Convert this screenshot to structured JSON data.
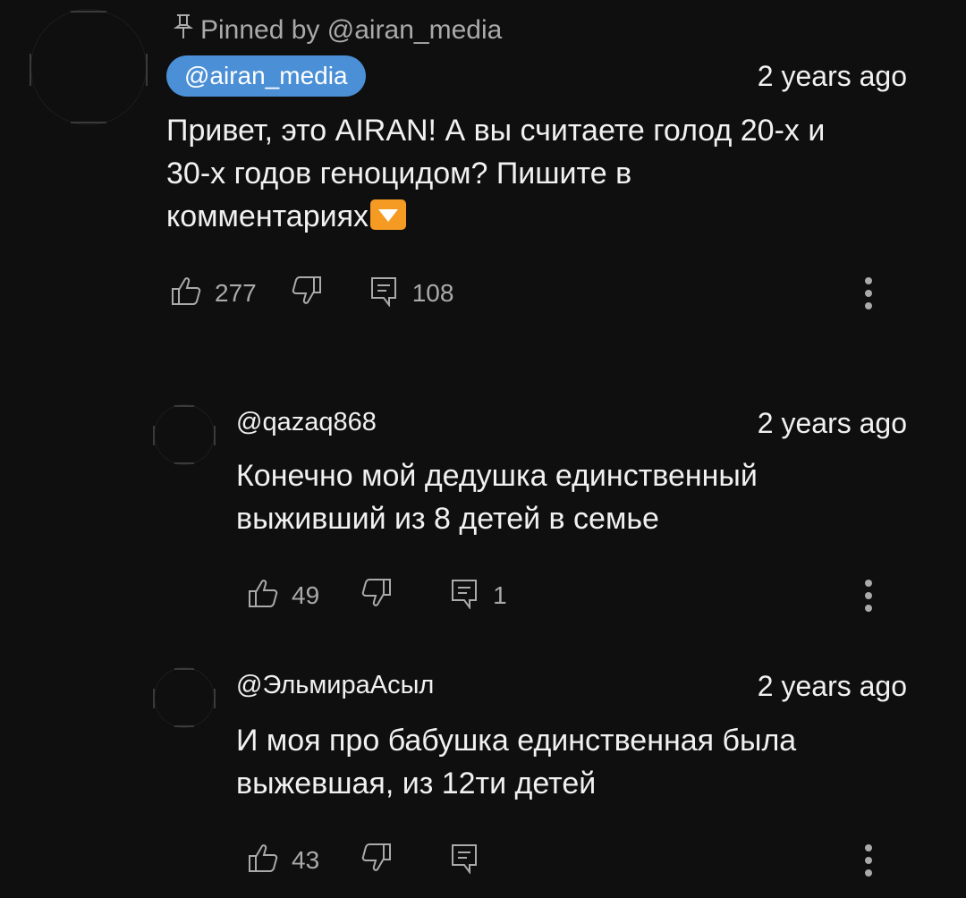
{
  "pinned": {
    "label": "Pinned by @airan_media",
    "icon": "pin-icon"
  },
  "comments": [
    {
      "author": "@airan_media",
      "is_creator": true,
      "time": "2 years ago",
      "text_line1": "Привет, это AIRAN! А вы считаете голод 20-х и",
      "text_line2": "30-х годов геноцидом? Пишите в",
      "text_line3": "комментариях",
      "likes": "277",
      "replies": "108",
      "creator_chip_color": "#4b8fd6"
    },
    {
      "author": "@qazaq868",
      "time": "2 years ago",
      "text_line1": "Конечно мой дедушка единственный",
      "text_line2": "выживший из 8 детей в семье",
      "likes": "49",
      "replies": "1"
    },
    {
      "author": "@ЭльмираАсыл",
      "time": "2 years ago",
      "text_line1": "И моя про бабушка единственная была",
      "text_line2": "выжевшая, из 12ти детей",
      "likes": "43",
      "replies": ""
    }
  ],
  "colors": {
    "background": "#0f0f0f",
    "primary_text": "#f1f1f1",
    "secondary_text": "#aaaaaa",
    "emoji_orange": "#f59a23"
  }
}
